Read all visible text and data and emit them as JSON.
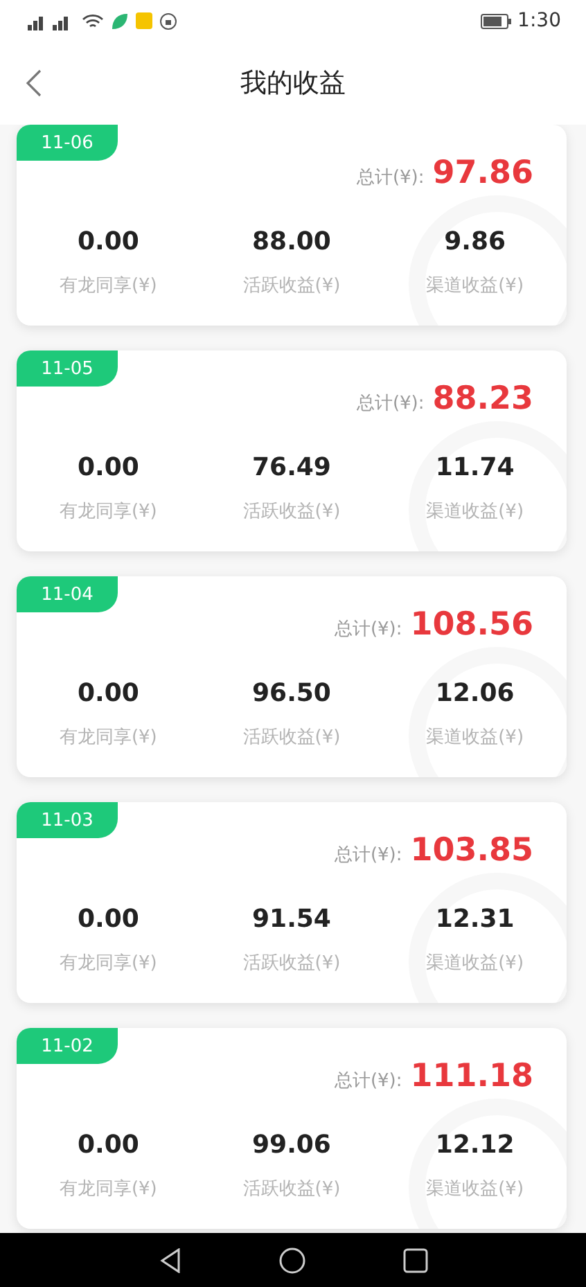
{
  "status_bar": {
    "time": "1:30"
  },
  "header": {
    "title": "我的收益"
  },
  "cards": [
    {
      "date": "11-06",
      "total_label": "总计(¥):",
      "total": "97.86",
      "items": [
        {
          "value": "0.00",
          "label": "有龙同享(¥)"
        },
        {
          "value": "88.00",
          "label": "活跃收益(¥)"
        },
        {
          "value": "9.86",
          "label": "渠道收益(¥)"
        }
      ]
    },
    {
      "date": "11-05",
      "total_label": "总计(¥):",
      "total": "88.23",
      "items": [
        {
          "value": "0.00",
          "label": "有龙同享(¥)"
        },
        {
          "value": "76.49",
          "label": "活跃收益(¥)"
        },
        {
          "value": "11.74",
          "label": "渠道收益(¥)"
        }
      ]
    },
    {
      "date": "11-04",
      "total_label": "总计(¥):",
      "total": "108.56",
      "items": [
        {
          "value": "0.00",
          "label": "有龙同享(¥)"
        },
        {
          "value": "96.50",
          "label": "活跃收益(¥)"
        },
        {
          "value": "12.06",
          "label": "渠道收益(¥)"
        }
      ]
    },
    {
      "date": "11-03",
      "total_label": "总计(¥):",
      "total": "103.85",
      "items": [
        {
          "value": "0.00",
          "label": "有龙同享(¥)"
        },
        {
          "value": "91.54",
          "label": "活跃收益(¥)"
        },
        {
          "value": "12.31",
          "label": "渠道收益(¥)"
        }
      ]
    },
    {
      "date": "11-02",
      "total_label": "总计(¥):",
      "total": "111.18",
      "items": [
        {
          "value": "0.00",
          "label": "有龙同享(¥)"
        },
        {
          "value": "99.06",
          "label": "活跃收益(¥)"
        },
        {
          "value": "12.12",
          "label": "渠道收益(¥)"
        }
      ]
    }
  ]
}
